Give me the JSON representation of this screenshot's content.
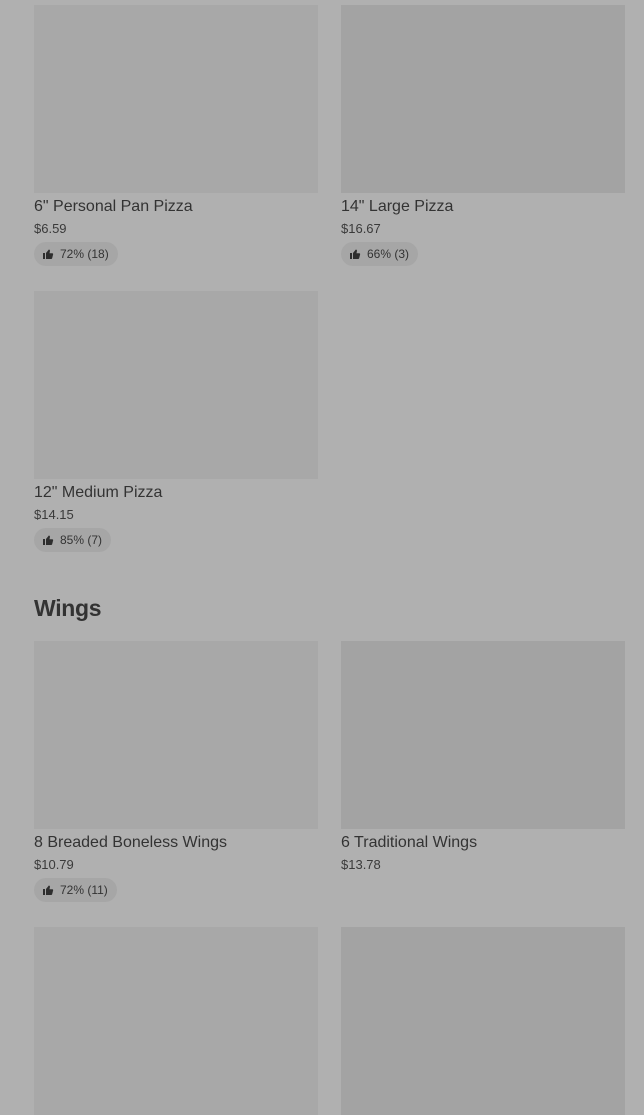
{
  "pizza_items": [
    {
      "name": "6\" Personal Pan Pizza",
      "price": "$6.59",
      "rating": "72% (18)"
    },
    {
      "name": "14\" Large Pizza",
      "price": "$16.67",
      "rating": "66% (3)"
    },
    {
      "name": "12\" Medium Pizza",
      "price": "$14.15",
      "rating": "85% (7)"
    }
  ],
  "sections": {
    "wings_title": "Wings"
  },
  "wings_items": [
    {
      "name": "8 Breaded Boneless Wings",
      "price": "$10.79",
      "rating": "72% (11)"
    },
    {
      "name": "6 Traditional Wings",
      "price": "$13.78"
    }
  ],
  "icons": {
    "rating": "thumbs-up-icon"
  },
  "colors": {
    "overlay_background": "#b0b0b0",
    "image_placeholder": "#a8a8a8",
    "text": "#333333"
  }
}
